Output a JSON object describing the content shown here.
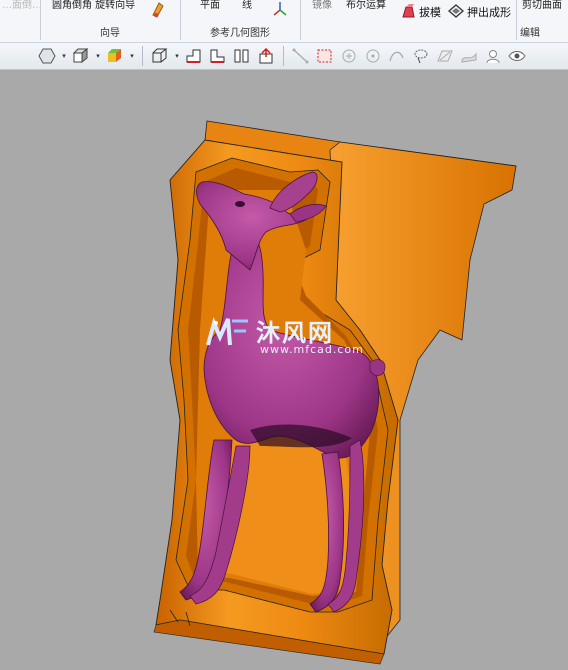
{
  "ribbon": {
    "cut_text_left": "…面倒…",
    "cut_text_group1": "圆角倒角 旋转向导",
    "cut_text_plane": "平面",
    "cut_text_line": "线",
    "cut_text_right1": "镜像",
    "cut_text_right2": "布尔运算",
    "cut_text_far": "剪切曲面",
    "draft_label": "拔模",
    "extrude_label": "押出成形",
    "group_wizard": "向导",
    "group_refgeom": "参考几何图形",
    "group_edit": "编辑"
  },
  "toolbar": {
    "icons": [
      "display-mode-icon",
      "box-view-icon",
      "shaded-cube-icon",
      "wireframe-box-icon",
      "section-plane-icon",
      "section-plane-2-icon",
      "split-view-icon",
      "clip-box-icon",
      "line-snap-icon",
      "select-rect-icon",
      "circle-point-icon",
      "circle-center-icon",
      "curve-icon",
      "lasso-icon",
      "plane-select-icon",
      "surface-icon",
      "face-select-icon",
      "eye-icon"
    ],
    "dropdown": "▾"
  },
  "watermark": {
    "cn": "沐风网",
    "url": "www.mfcad.com"
  },
  "colors": {
    "mold_orange": "#ee8a12",
    "mold_dark": "#a04e00",
    "deer_purple": "#b0429a",
    "viewport_bg": "#a9a9a9"
  }
}
